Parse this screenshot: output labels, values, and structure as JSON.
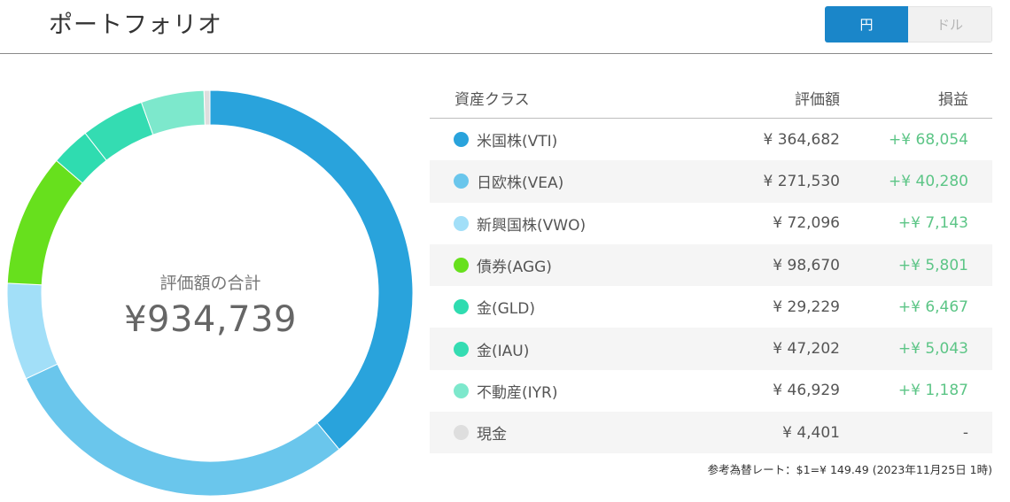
{
  "header": {
    "title": "ポートフォリオ",
    "currency_options": [
      "円",
      "ドル"
    ],
    "currency_selected": "円"
  },
  "summary": {
    "caption": "評価額の合計",
    "total": "¥934,739"
  },
  "table": {
    "columns": [
      "資産クラス",
      "評価額",
      "損益"
    ],
    "rows": [
      {
        "name": "米国株(VTI)",
        "value": "¥ 364,682",
        "pl": "+¥ 68,054",
        "color": "#29a3dc"
      },
      {
        "name": "日欧株(VEA)",
        "value": "¥ 271,530",
        "pl": "+¥ 40,280",
        "color": "#6ac6ec"
      },
      {
        "name": "新興国株(VWO)",
        "value": "¥ 72,096",
        "pl": "+¥ 7,143",
        "color": "#a2dff8"
      },
      {
        "name": "債券(AGG)",
        "value": "¥ 98,670",
        "pl": "+¥ 5,801",
        "color": "#67e01d"
      },
      {
        "name": "金(GLD)",
        "value": "¥ 29,229",
        "pl": "+¥ 6,467",
        "color": "#2fdcb0"
      },
      {
        "name": "金(IAU)",
        "value": "¥ 47,202",
        "pl": "+¥ 5,043",
        "color": "#34dcb2"
      },
      {
        "name": "不動産(IYR)",
        "value": "¥ 46,929",
        "pl": "+¥ 1,187",
        "color": "#7de8cc"
      },
      {
        "name": "現金",
        "value": "¥ 4,401",
        "pl": "-",
        "color": "#dedede"
      }
    ]
  },
  "fx_note": "参考為替レート：$1=¥ 149.49 (2023年11月25日 1時)",
  "chart_data": {
    "type": "pie",
    "categories": [
      "米国株(VTI)",
      "日欧株(VEA)",
      "新興国株(VWO)",
      "債券(AGG)",
      "金(GLD)",
      "金(IAU)",
      "不動産(IYR)",
      "現金"
    ],
    "values": [
      364682,
      271530,
      72096,
      98670,
      29229,
      47202,
      46929,
      4401
    ],
    "colors": [
      "#29a3dc",
      "#6ac6ec",
      "#a2dff8",
      "#67e01d",
      "#2fdcb0",
      "#34dcb2",
      "#7de8cc",
      "#dedede"
    ],
    "donut": true,
    "start": "top",
    "direction": "clockwise"
  }
}
